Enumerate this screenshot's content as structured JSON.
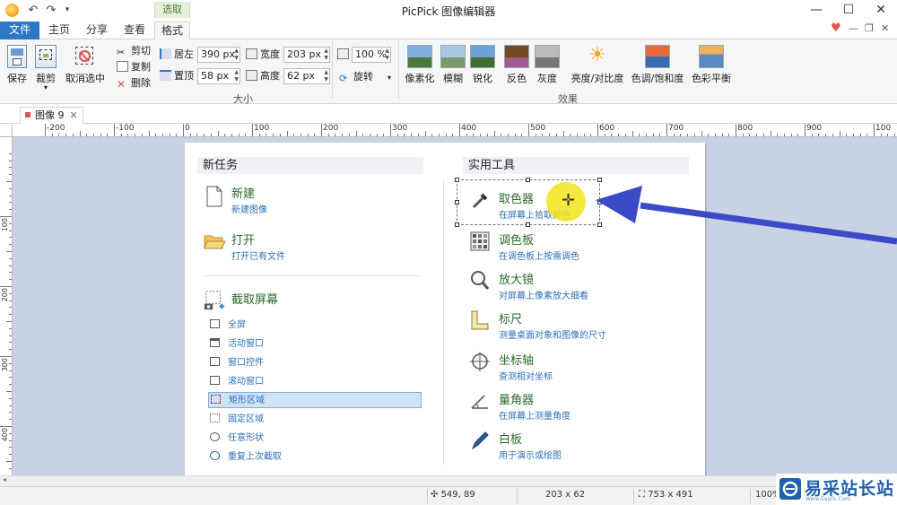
{
  "app": {
    "title": "PicPick 图像编辑器"
  },
  "ribbon_tabs": {
    "contextual_header": "选取",
    "tabs": [
      {
        "label": "文件"
      },
      {
        "label": "主页"
      },
      {
        "label": "分享"
      },
      {
        "label": "查看"
      },
      {
        "label": "格式"
      }
    ]
  },
  "ribbon": {
    "save": "保存",
    "crop": "裁剪",
    "deselect": "取消选中",
    "cut": "剪切",
    "copy": "复制",
    "delete": "删除",
    "left_label": "居左",
    "left_value": "390 px",
    "top_label": "置顶",
    "top_value": "58 px",
    "width_label": "宽度",
    "width_value": "203 px",
    "height_label": "高度",
    "height_value": "62 px",
    "size_group": "大小",
    "zoom_value": "100 %",
    "rotate": "旋转",
    "pixelate": "像素化",
    "blur": "模糊",
    "sharpen": "锐化",
    "invert": "反色",
    "grayscale": "灰度",
    "brightness": "亮度/对比度",
    "hue": "色调/饱和度",
    "color_balance": "色彩平衡",
    "effects_group": "效果"
  },
  "doc_tab": {
    "label": "图像 9"
  },
  "ruler": {
    "h_labels": [
      "-200",
      "-100",
      "0",
      "100",
      "200",
      "300",
      "400",
      "500",
      "600",
      "700",
      "800",
      "900",
      "100"
    ],
    "v_labels": [
      "100",
      "200",
      "300",
      "400"
    ]
  },
  "panel": {
    "new_task": "新任务",
    "new": {
      "title": "新建",
      "sub": "新建图像"
    },
    "open": {
      "title": "打开",
      "sub": "打开已有文件"
    },
    "capture": "截取屏幕",
    "capture_items": [
      {
        "label": "全屏"
      },
      {
        "label": "活动窗口"
      },
      {
        "label": "窗口控件"
      },
      {
        "label": "滚动窗口"
      },
      {
        "label": "矩形区域"
      },
      {
        "label": "固定区域"
      },
      {
        "label": "任意形状"
      },
      {
        "label": "重复上次截取"
      }
    ],
    "tools_head": "实用工具",
    "tools": [
      {
        "title": "取色器",
        "sub": "在屏幕上拾取颜色"
      },
      {
        "title": "调色板",
        "sub": "在调色板上按需调色"
      },
      {
        "title": "放大镜",
        "sub": "对屏幕上像素放大细看"
      },
      {
        "title": "标尺",
        "sub": "测量桌面对象和图像的尺寸"
      },
      {
        "title": "坐标轴",
        "sub": "查测相对坐标"
      },
      {
        "title": "量角器",
        "sub": "在屏幕上测量角度"
      },
      {
        "title": "白板",
        "sub": "用于演示或绘图"
      }
    ]
  },
  "status": {
    "cursor": "549, 89",
    "selection": "203 x 62",
    "image_size": "753 x 491",
    "zoom": "100%"
  },
  "watermark": {
    "text": "易采站长站",
    "sub": "Www.Easck.Com"
  },
  "colors": {
    "accent": "#2b78c5",
    "canvas_bg": "#c8d2e4",
    "arrow": "#3b4bc8",
    "highlight": "#f5e31c"
  }
}
